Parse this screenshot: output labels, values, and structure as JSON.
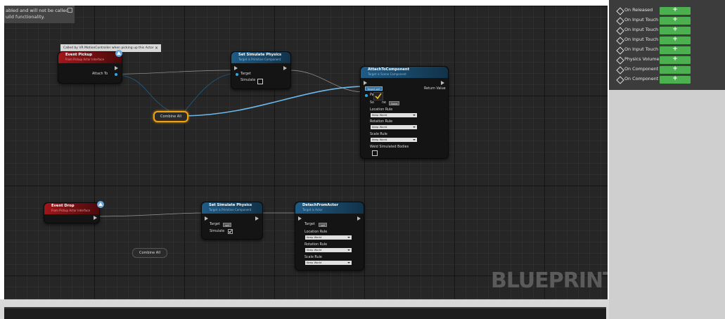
{
  "warning": {
    "line1": "abled and will not be called",
    "line2": "uild functionality."
  },
  "tooltip": {
    "text": "Called by VR MotionController when picking up this Actor",
    "close": "×"
  },
  "nodes": {
    "event_pickup": {
      "title": "Event Pickup",
      "subtitle": "From Pickup Actor Interface",
      "attach_to_label": "Attach To"
    },
    "set_sim_physics_1": {
      "title": "Set Simulate Physics",
      "subtitle": "Target is Primitive Component",
      "target_label": "Target",
      "simulate_label": "Simulate"
    },
    "attach_to_component": {
      "title": "AttachToComponent",
      "subtitle": "Target is Scene Component",
      "target_label": "Target",
      "target_self": "self",
      "return_label": "Return Value",
      "pa_label": "Pa",
      "socket_label": "So",
      "socket_name": "ne",
      "socket_value": "None",
      "location_rule_label": "Location Rule",
      "location_rule_value": "Keep World",
      "rotation_rule_label": "Rotation Rule",
      "rotation_rule_value": "Keep World",
      "scale_rule_label": "Scale Rule",
      "scale_rule_value": "Keep World",
      "weld_label": "Weld Simulated Bodies"
    },
    "combine_all_1": {
      "label": "Combine All"
    },
    "event_drop": {
      "title": "Event Drop",
      "subtitle": "From Pickup Actor Interface"
    },
    "set_sim_physics_2": {
      "title": "Set Simulate Physics",
      "subtitle": "Target is Primitive Component",
      "target_label": "Target",
      "target_self": "self",
      "simulate_label": "Simulate"
    },
    "detach_from_actor": {
      "title": "DetachFromActor",
      "subtitle": "Target is Actor",
      "target_label": "Target",
      "target_self": "self",
      "location_rule_label": "Location Rule",
      "location_rule_value": "Keep World",
      "rotation_rule_label": "Rotation Rule",
      "rotation_rule_value": "Keep World",
      "scale_rule_label": "Scale Rule",
      "scale_rule_value": "Keep World"
    },
    "combine_all_2": {
      "label": "Combine All"
    }
  },
  "watermark": "BLUEPRINT",
  "events": [
    {
      "label": "On Released",
      "add": "+"
    },
    {
      "label": "On Input Touch E",
      "add": "+"
    },
    {
      "label": "On Input Touch E",
      "add": "+"
    },
    {
      "label": "On Input Touch E",
      "add": "+"
    },
    {
      "label": "On Input Touch L",
      "add": "+"
    },
    {
      "label": "Physics Volume",
      "add": "+"
    },
    {
      "label": "On Component A",
      "add": "+"
    },
    {
      "label": "On Component D",
      "add": "+"
    }
  ],
  "colors": {
    "graph_bg": "#262626",
    "function_header": "#1e5c86",
    "event_header": "#a0161a",
    "add_button": "#4caf50",
    "selection": "#f0a010",
    "wire": "#2fa8e8"
  }
}
